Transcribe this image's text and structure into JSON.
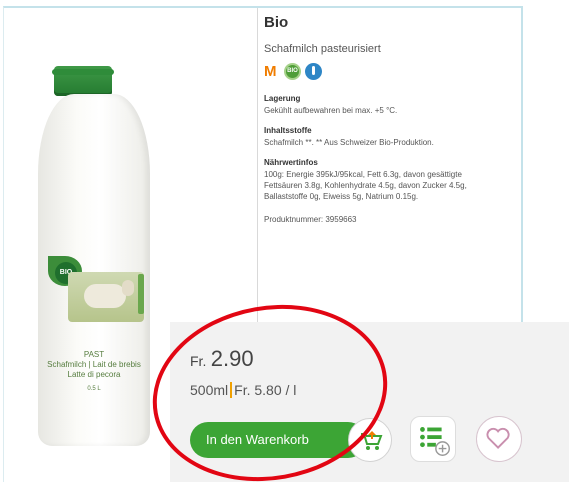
{
  "product": {
    "title": "Bio",
    "subtitle": "Schafmilch pasteurisiert",
    "badges": [
      {
        "icon": "migros-m-icon",
        "text": "M",
        "color": "#f07d00"
      },
      {
        "icon": "bio-icon",
        "text": "BIO",
        "color": "#4f9e38"
      },
      {
        "icon": "thermometer-icon",
        "color": "#2e86c6"
      }
    ],
    "sections": [
      {
        "heading": "Lagerung",
        "text": "Gekühlt aufbewahren bei max. +5 °C."
      },
      {
        "heading": "Inhaltsstoffe",
        "text": "Schafmilch **. ** Aus Schweizer Bio-Produktion."
      },
      {
        "heading": "Nährwertinfos",
        "text": "100g: Energie 395kJ/95kcal, Fett 6.3g, davon gesättigte\nFettsäuren 3.8g, Kohlenhydrate 4.5g, davon Zucker 4.5g,\nBallaststoffe 0g, Eiweiss 5g, Natrium 0.15g."
      }
    ],
    "product_number": "Produktnummer: 3959663"
  },
  "bottle_label": {
    "brand_badge": "BIO",
    "lines": [
      "PAST",
      "Schafmilch | Lait de brebis",
      "Latte di pecora",
      "0.5 L"
    ]
  },
  "price_panel": {
    "currency": "Fr.",
    "price": "2.90",
    "size": "500ml",
    "unit_price": "Fr. 5.80 / l",
    "cart_button_label": "In den Warenkorb",
    "accent_color": "#3ca535",
    "highlight_color": "#e20613"
  }
}
